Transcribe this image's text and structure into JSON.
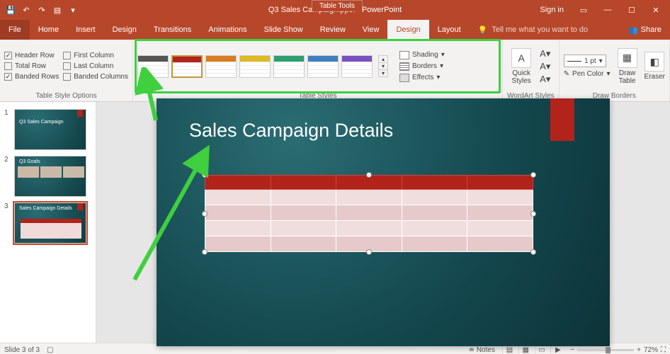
{
  "titlebar": {
    "doc_title": "Q3 Sales Campaign.pptx  -  PowerPoint",
    "table_tools": "Table Tools",
    "signin": "Sign in"
  },
  "tabs": {
    "file": "File",
    "home": "Home",
    "insert": "Insert",
    "design": "Design",
    "transitions": "Transitions",
    "animations": "Animations",
    "slideshow": "Slide Show",
    "review": "Review",
    "view": "View",
    "tdesign": "Design",
    "layout": "Layout",
    "tellme": "Tell me what you want to do",
    "share": "Share"
  },
  "options": {
    "header_row": "Header Row",
    "total_row": "Total Row",
    "banded_rows": "Banded Rows",
    "first_col": "First Column",
    "last_col": "Last Column",
    "banded_cols": "Banded Columns",
    "group_label": "Table Style Options"
  },
  "styles": {
    "group_label": "Table Styles",
    "shading": "Shading",
    "borders": "Borders",
    "effects": "Effects",
    "colors": [
      "#555555",
      "#b2231c",
      "#d97b1f",
      "#e0b81f",
      "#2e9e6f",
      "#3f7fbf",
      "#7a4fbf"
    ]
  },
  "wordart": {
    "quick": "Quick Styles",
    "group_label": "WordArt Styles"
  },
  "drawborders": {
    "pen_width": "1 pt",
    "pen_color": "Pen Color",
    "draw_table": "Draw Table",
    "eraser": "Eraser",
    "group_label": "Draw Borders"
  },
  "slide": {
    "title": "Sales Campaign Details"
  },
  "thumbs": {
    "t1": "Q3 Sales Campaign",
    "t2": "Q3 Goals",
    "t3": "Sales Campaign Details"
  },
  "status": {
    "slide": "Slide 3 of 3",
    "notes": "Notes",
    "zoom": "72%"
  }
}
